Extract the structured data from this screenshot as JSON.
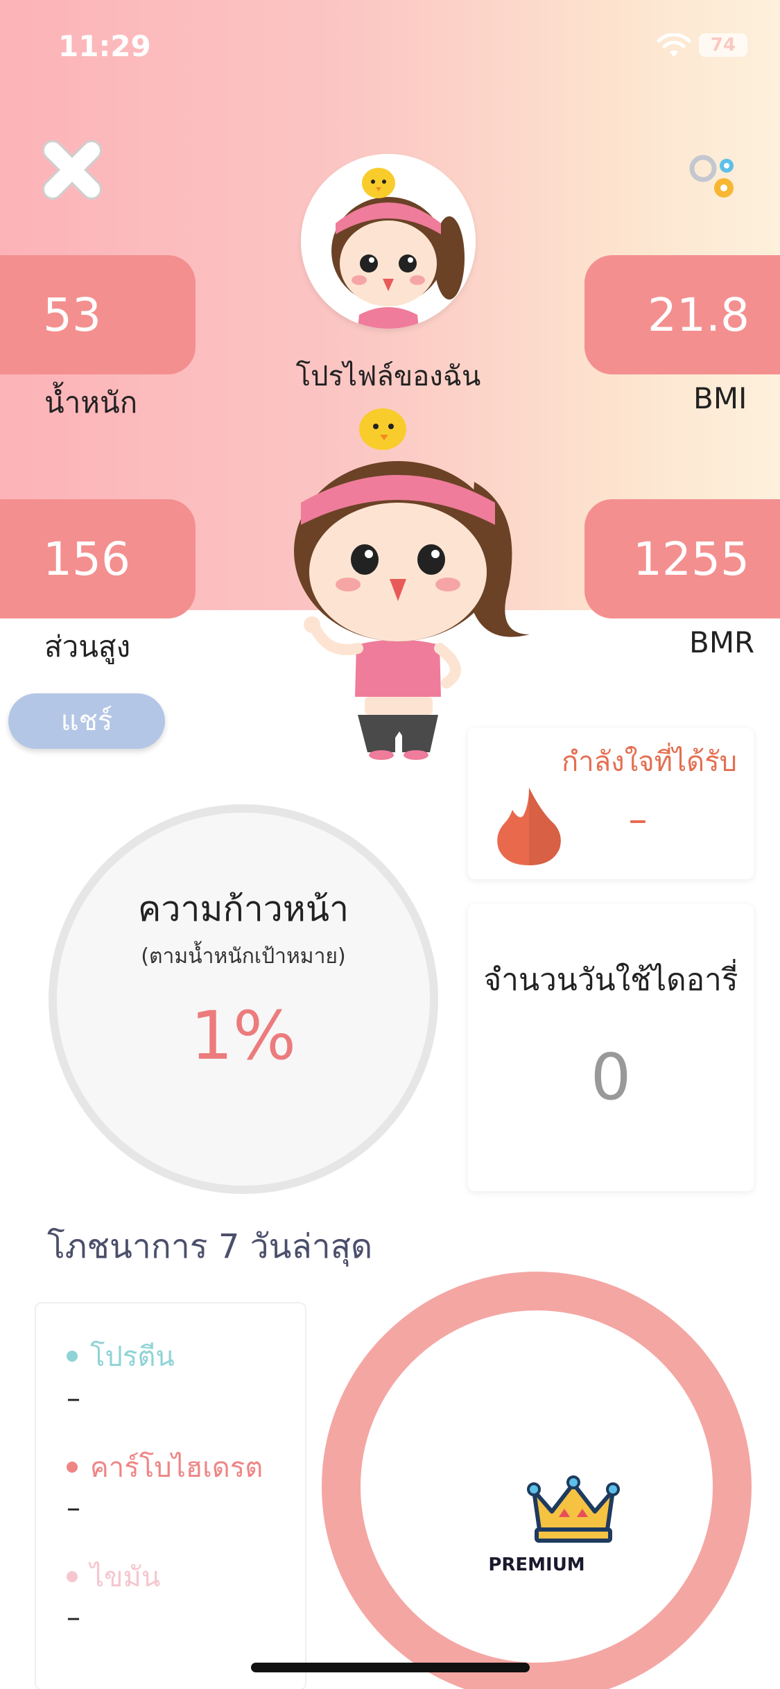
{
  "status_bar": {
    "time": "11:29",
    "battery": "74"
  },
  "profile": {
    "name": "โปรไฟล์ของฉัน"
  },
  "stats": {
    "weight": {
      "value": "53",
      "label": "น้ำหนัก"
    },
    "bmi": {
      "value": "21.8",
      "label": "BMI"
    },
    "height": {
      "value": "156",
      "label": "ส่วนสูง"
    },
    "bmr": {
      "value": "1255",
      "label": "BMR"
    }
  },
  "share_label": "แชร์",
  "encouragement": {
    "title": "กำลังใจที่ได้รับ",
    "value": "–",
    "icon": "flame-icon"
  },
  "diary_days": {
    "title": "จำนวนวันใช้ไดอารี่",
    "value": "0"
  },
  "progress": {
    "title": "ความก้าวหน้า",
    "subtitle": "(ตามน้ำหนักเป้าหมาย)",
    "value": "1%"
  },
  "nutrition": {
    "title": "โภชนาการ 7 วันล่าสุด",
    "items": [
      {
        "label": "โปรตีน",
        "value": "–",
        "color": "#8fd3d6"
      },
      {
        "label": "คาร์โบไฮเดรต",
        "value": "–",
        "color": "#ef8585"
      },
      {
        "label": "ไขมัน",
        "value": "–",
        "color": "#f6c6cf"
      }
    ]
  },
  "premium": {
    "label": "PREMIUM"
  },
  "colors": {
    "accent": "#f48f8f",
    "share": "#b4c6e6",
    "premium_ring": "#f4a6a3",
    "flame": "#e9694d"
  }
}
